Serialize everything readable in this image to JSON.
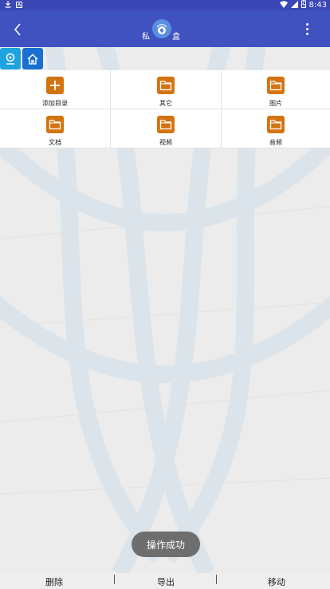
{
  "status_bar": {
    "time": "8:43"
  },
  "app_bar": {
    "title_left": "私",
    "title_right": "盒"
  },
  "grid": {
    "items": [
      {
        "label": "添加目录",
        "icon": "plus-icon"
      },
      {
        "label": "其它",
        "icon": "folder-icon"
      },
      {
        "label": "图片",
        "icon": "folder-icon"
      },
      {
        "label": "文档",
        "icon": "folder-icon"
      },
      {
        "label": "视频",
        "icon": "folder-icon"
      },
      {
        "label": "音频",
        "icon": "folder-icon"
      }
    ]
  },
  "toast": {
    "text": "操作成功"
  },
  "bottom_bar": {
    "delete_label": "删除",
    "export_label": "导出",
    "move_label": "移动"
  },
  "colors": {
    "app_bar": "#4052c0",
    "status_bar": "#3a47b5",
    "accent_orange": "#d47411",
    "search_btn": "#1fa3df",
    "home_btn": "#1a6fd0"
  }
}
